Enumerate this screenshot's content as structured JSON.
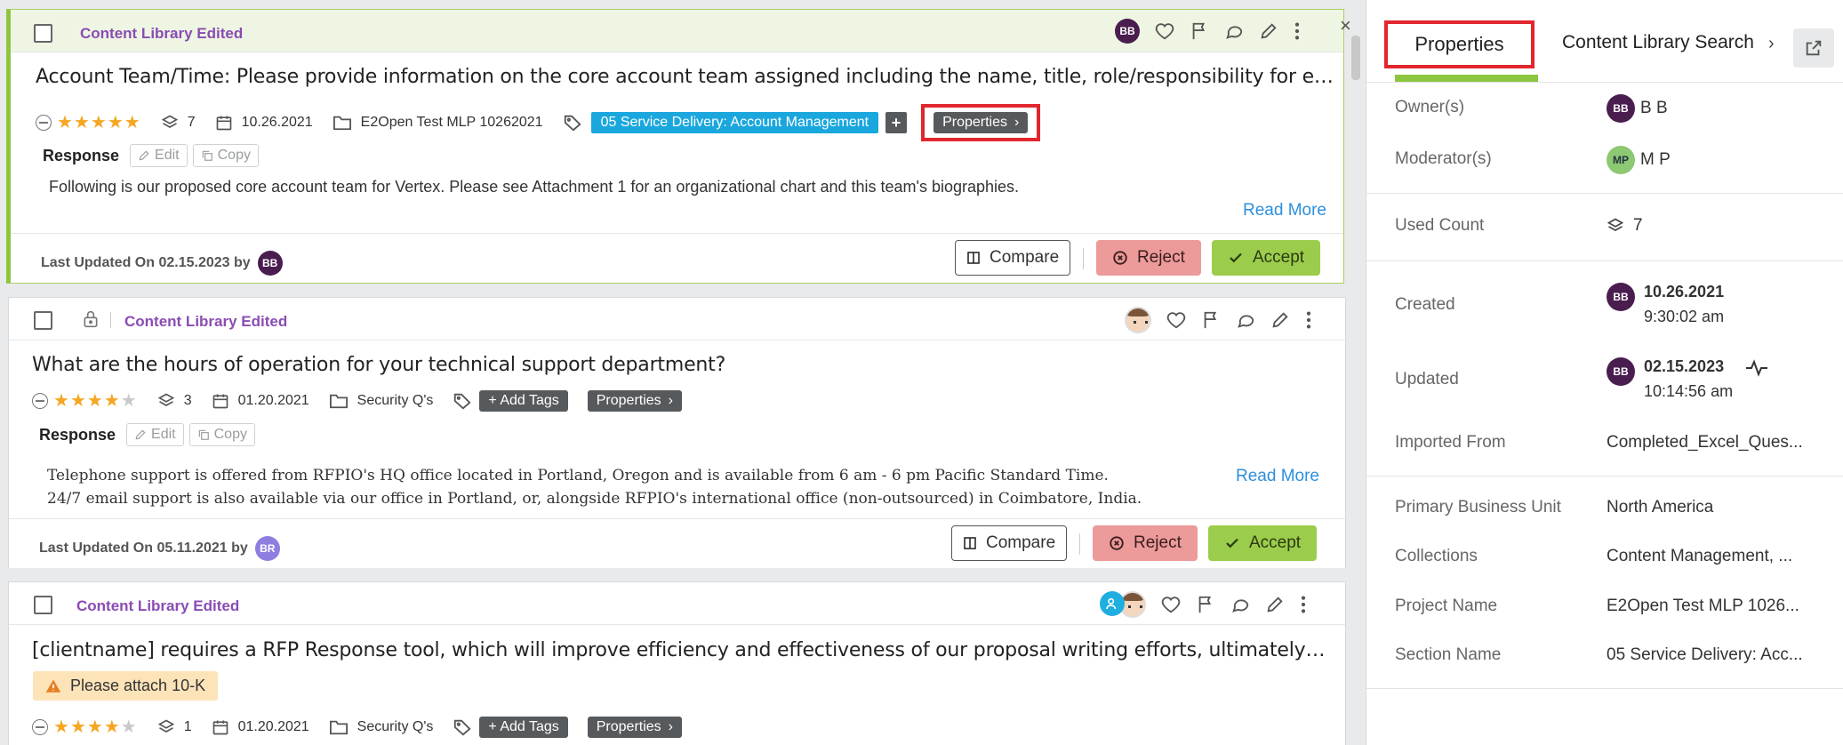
{
  "cards": [
    {
      "status": "Content Library Edited",
      "title": "Account Team/Time: Please provide information on the core account team assigned including the name, title, role/responsibility for each p...",
      "rating": 5,
      "used_count": "7",
      "date": "10.26.2021",
      "project": "E2Open Test MLP 10262021",
      "tag": "05 Service Delivery: Account Management",
      "add_tag_symbol": "+",
      "properties_label": "Properties",
      "response_label": "Response",
      "edit_label": "Edit",
      "copy_label": "Copy",
      "response_text": "Following is our proposed core account team for Vertex. Please see Attachment 1 for an organizational chart and this team's biographies.",
      "read_more": "Read More",
      "last_updated": "Last Updated On 02.15.2023 by",
      "updater_initials": "BB",
      "compare_label": "Compare",
      "reject_label": "Reject",
      "accept_label": "Accept",
      "owner_initials": "BB"
    },
    {
      "status": "Content Library Edited",
      "title": "What are the hours of operation for your technical support department?",
      "rating": 4,
      "used_count": "3",
      "date": "01.20.2021",
      "project": "Security Q's",
      "add_tags": "+ Add Tags",
      "properties_label": "Properties",
      "response_label": "Response",
      "edit_label": "Edit",
      "copy_label": "Copy",
      "response_lines": [
        "Telephone support is offered from RFPIO's HQ office located in Portland, Oregon and is available from 6 am - 6 pm Pacific Standard Time.",
        "24/7 email support is also available via our office in Portland, or, alongside RFPIO's international office (non-outsourced) in Coimbatore, India."
      ],
      "read_more": "Read More",
      "last_updated": "Last Updated On 05.11.2021 by",
      "updater_initials": "BR",
      "compare_label": "Compare",
      "reject_label": "Reject",
      "accept_label": "Accept"
    },
    {
      "status": "Content Library Edited",
      "title": "[clientname] requires a RFP Response tool, which will improve efficiency and effectiveness of our proposal writing efforts, ultimately leadin...",
      "warning": "Please attach 10-K",
      "rating": 4,
      "used_count": "1",
      "date": "01.20.2021",
      "project": "Security Q's",
      "add_tags": "+ Add Tags",
      "properties_label": "Properties"
    }
  ],
  "panel": {
    "close_symbol": "×",
    "tab_properties": "Properties",
    "tab_search": "Content Library Search",
    "chevron": "›",
    "rows": {
      "owners_label": "Owner(s)",
      "owners_initials": "BB",
      "owners_value": "B B",
      "moderators_label": "Moderator(s)",
      "moderators_initials": "MP",
      "moderators_value": "M P",
      "used_count_label": "Used Count",
      "used_count_value": "7",
      "created_label": "Created",
      "created_date": "10.26.2021",
      "created_time": "9:30:02 am",
      "updated_label": "Updated",
      "updated_date": "02.15.2023",
      "updated_time": "10:14:56 am",
      "imported_from_label": "Imported From",
      "imported_from_value": "Completed_Excel_Ques...",
      "business_unit_label": "Primary Business Unit",
      "business_unit_value": "North America",
      "collections_label": "Collections",
      "collections_value": "Content Management, ...",
      "project_name_label": "Project Name",
      "project_name_value": "E2Open Test MLP 1026...",
      "section_name_label": "Section Name",
      "section_name_value": "05 Service Delivery: Acc..."
    }
  },
  "colors": {
    "accent_green": "#8cc63f",
    "highlight_red": "#e2262e",
    "avatar_purple": "#4a1d4f",
    "tag_blue": "#1aa7dd",
    "link_blue": "#2d8fdc"
  },
  "icons": [
    "checkbox-icon",
    "heart-icon",
    "flag-icon",
    "comment-icon",
    "pencil-icon",
    "more-vertical-icon",
    "layers-icon",
    "calendar-icon",
    "folder-icon",
    "tag-icon",
    "lock-icon",
    "share-icon",
    "activity-icon",
    "warning-icon"
  ]
}
